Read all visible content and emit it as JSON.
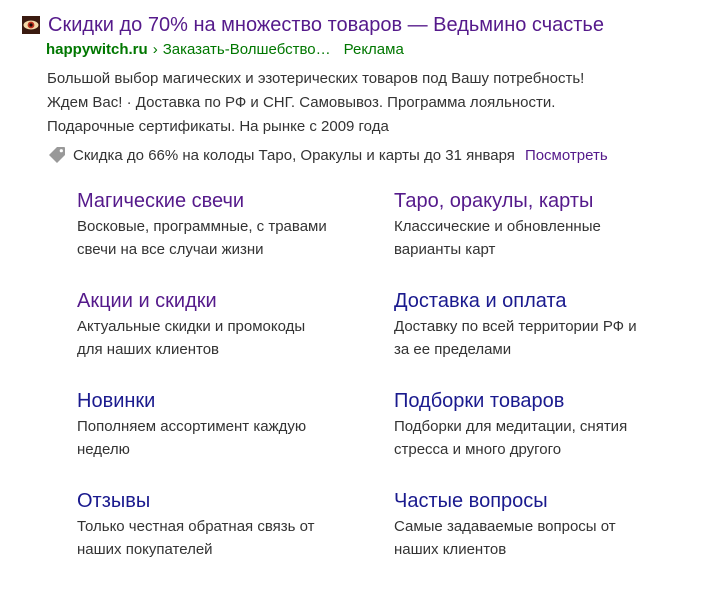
{
  "ad": {
    "title": "Скидки до 70% на множество товаров — Ведьмино счастье",
    "favicon_icon": "eye-icon",
    "domain": "happywitch.ru",
    "url_separator": "›",
    "url_path": "Заказать-Волшебство…",
    "ad_label": "Реклама",
    "description_lines": [
      "Большой выбор магических и эзотерических товаров под Вашу потребность!",
      "Ждем Вас! · Доставка по РФ и СНГ. Самовывоз. Программа лояльности.",
      "Подарочные сертификаты. На рынке с 2009 года"
    ],
    "promo": {
      "icon": "price-tag-icon",
      "text": "Скидка до 66% на колоды Таро, Оракулы и карты до 31 января",
      "link": "Посмотреть"
    }
  },
  "sitelinks": [
    {
      "title": "Магические свечи",
      "desc_lines": [
        "Восковые, программные, с травами",
        "свечи на все случаи жизни"
      ]
    },
    {
      "title": "Таро, оракулы, карты",
      "desc_lines": [
        "Классические и обновленные",
        "варианты карт"
      ]
    },
    {
      "title": "Акции и скидки",
      "desc_lines": [
        "Актуальные скидки и промокоды",
        "для наших клиентов"
      ]
    },
    {
      "title": "Доставка и оплата",
      "desc_lines": [
        "Доставку по всей территории РФ и",
        "за ее пределами"
      ]
    },
    {
      "title": "Новинки",
      "desc_lines": [
        "Пополняем ассортимент каждую",
        "неделю"
      ]
    },
    {
      "title": "Подборки товаров",
      "desc_lines": [
        "Подборки для медитации, снятия",
        "стресса и много другого"
      ]
    },
    {
      "title": "Отзывы",
      "desc_lines": [
        "Только честная обратная связь от",
        "наших покупателей"
      ]
    },
    {
      "title": "Частые вопросы",
      "desc_lines": [
        "Самые задаваемые вопросы от",
        "наших клиентов"
      ]
    }
  ],
  "colors": {
    "link_visited": "#551a8b",
    "link_unvisited": "#1a1a8e",
    "url_green": "#007700",
    "text": "#333333"
  }
}
